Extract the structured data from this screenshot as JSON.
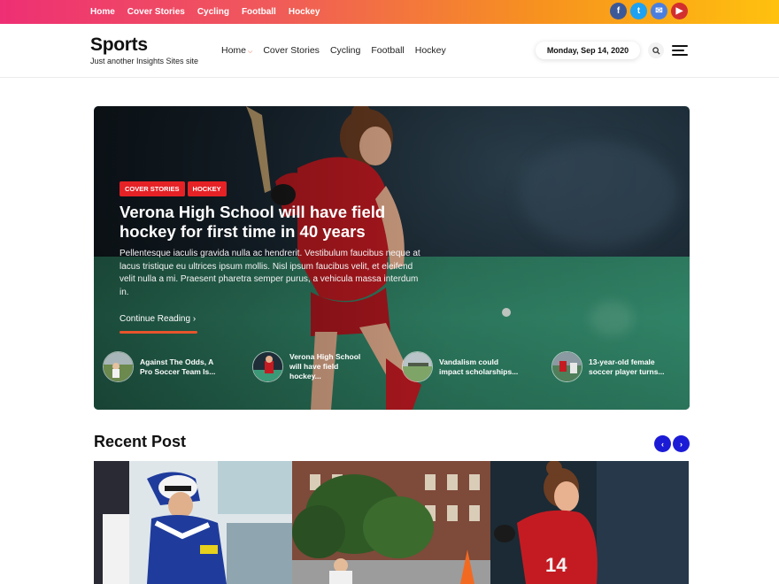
{
  "topbar": {
    "nav": [
      "Home",
      "Cover Stories",
      "Cycling",
      "Football",
      "Hockey"
    ],
    "socials": [
      {
        "name": "facebook-icon",
        "glyph": "f"
      },
      {
        "name": "twitter-icon",
        "glyph": "t"
      },
      {
        "name": "email-icon",
        "glyph": "✉"
      },
      {
        "name": "youtube-icon",
        "glyph": "▶"
      }
    ]
  },
  "header": {
    "site_title": "Sports",
    "tagline": "Just another Insights Sites site",
    "nav": [
      "Home",
      "Cover Stories",
      "Cycling",
      "Football",
      "Hockey"
    ],
    "active_nav": "Home",
    "date": "Monday, Sep 14, 2020"
  },
  "hero": {
    "tags": [
      "COVER STORIES",
      "HOCKEY"
    ],
    "title": "Verona High School will have field hockey for first time in 40 years",
    "excerpt": "Pellentesque iaculis gravida nulla ac hendrerit. Vestibulum faucibus neque at lacus tristique eu ultrices ipsum mollis. Nisl ipsum faucibus velit, et eleifend velit nulla a mi. Praesent pharetra semper purus, a vehicula massa interdum in.",
    "continue_label": "Continue Reading",
    "continue_arrow": "›",
    "mini_posts": [
      {
        "title": "Against The Odds, A Pro Soccer Team Is..."
      },
      {
        "title": "Verona High School will have field hockey..."
      },
      {
        "title": "Vandalism could impact scholarships..."
      },
      {
        "title": "13-year-old female soccer player turns..."
      }
    ]
  },
  "recent": {
    "title": "Recent Post",
    "prev_arrow": "‹",
    "next_arrow": "›"
  },
  "colors": {
    "accent": "#e8542c",
    "tag_red": "#e52226",
    "arrow_blue": "#1b1bd6"
  }
}
